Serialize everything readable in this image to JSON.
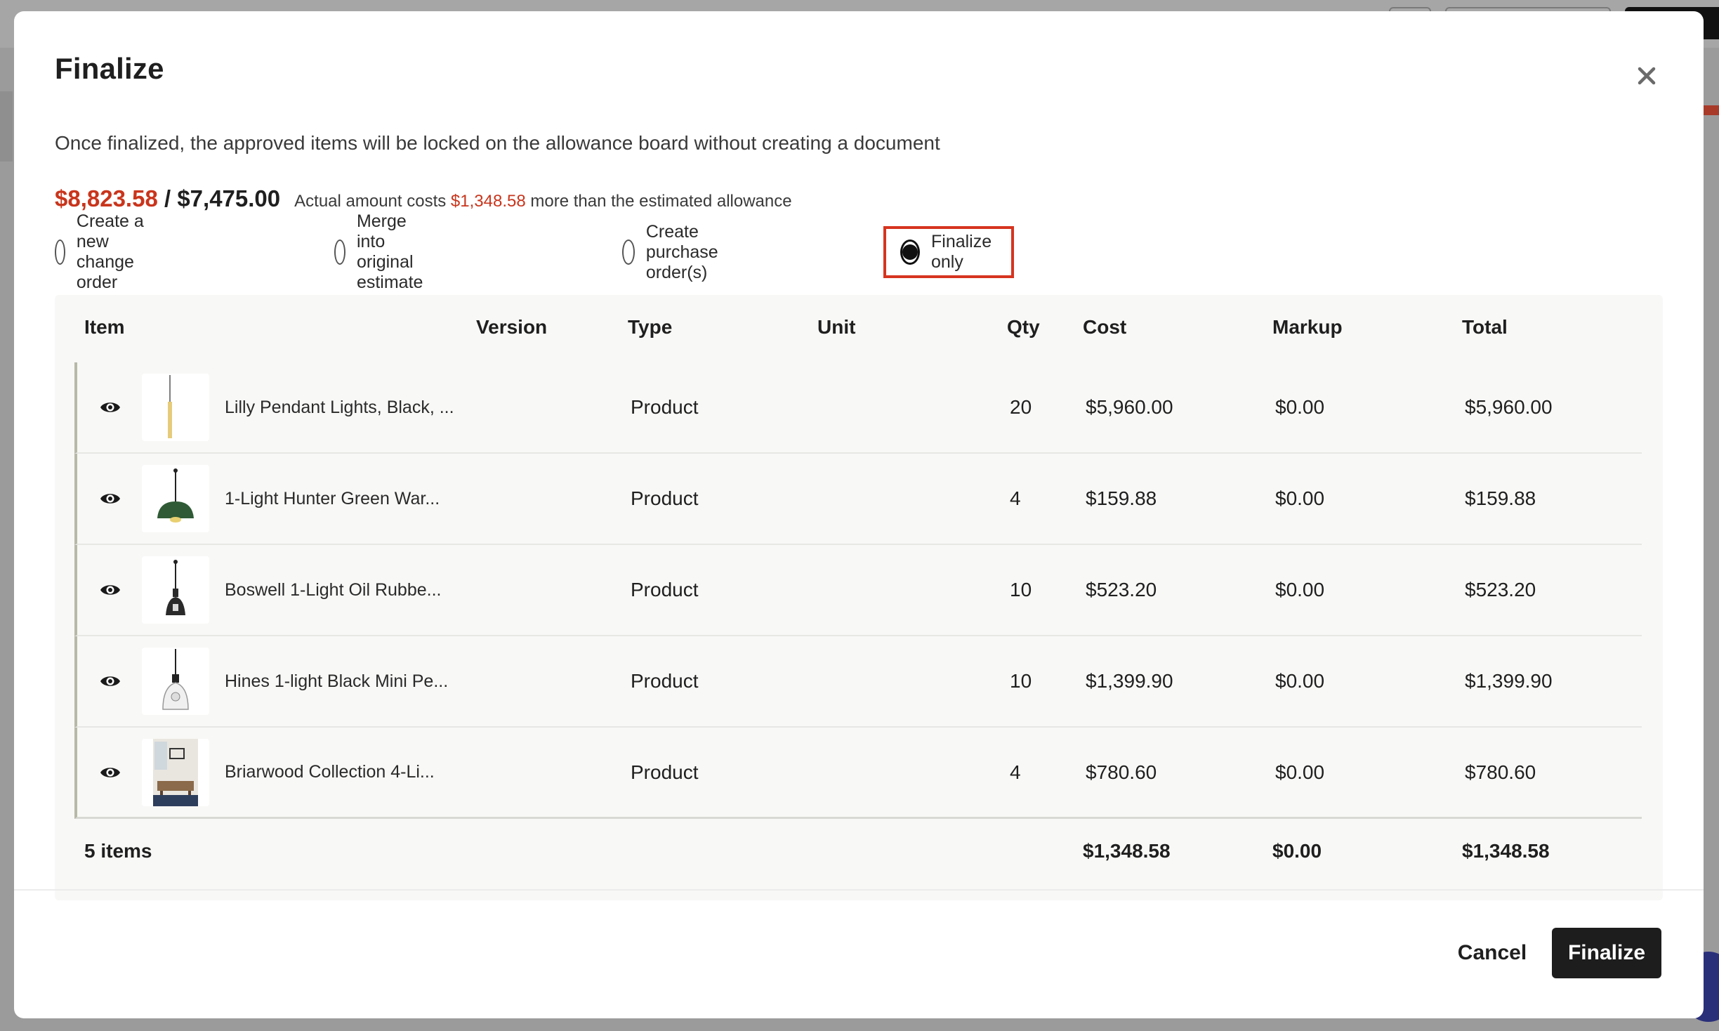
{
  "modal": {
    "title": "Finalize",
    "description": "Once finalized, the approved items will be locked on the allowance board without creating a document"
  },
  "amounts": {
    "actual": "$8,823.58",
    "separator": "/",
    "estimated": "$7,475.00",
    "note_prefix": "Actual amount costs",
    "difference": "$1,348.58",
    "note_suffix": "more than the estimated allowance"
  },
  "options": [
    {
      "label": "Create a new change order",
      "checked": false
    },
    {
      "label": "Merge into original estimate",
      "checked": false
    },
    {
      "label": "Create purchase order(s)",
      "checked": false
    },
    {
      "label": "Finalize only",
      "checked": true
    }
  ],
  "table": {
    "headers": {
      "item": "Item",
      "version": "Version",
      "type": "Type",
      "unit": "Unit",
      "qty": "Qty",
      "cost": "Cost",
      "markup": "Markup",
      "total": "Total"
    },
    "rows": [
      {
        "name": "Lilly Pendant Lights, Black, ...",
        "version": "",
        "type": "Product",
        "unit": "",
        "qty": "20",
        "cost": "$5,960.00",
        "markup": "$0.00",
        "total": "$5,960.00",
        "thumb_icon": "pendant-light-gold-icon"
      },
      {
        "name": "1-Light Hunter Green War...",
        "version": "",
        "type": "Product",
        "unit": "",
        "qty": "4",
        "cost": "$159.88",
        "markup": "$0.00",
        "total": "$159.88",
        "thumb_icon": "pendant-light-green-icon"
      },
      {
        "name": "Boswell 1-Light Oil Rubbe...",
        "version": "",
        "type": "Product",
        "unit": "",
        "qty": "10",
        "cost": "$523.20",
        "markup": "$0.00",
        "total": "$523.20",
        "thumb_icon": "pendant-light-bronze-icon"
      },
      {
        "name": "Hines 1-light Black Mini Pe...",
        "version": "",
        "type": "Product",
        "unit": "",
        "qty": "10",
        "cost": "$1,399.90",
        "markup": "$0.00",
        "total": "$1,399.90",
        "thumb_icon": "pendant-light-glass-icon"
      },
      {
        "name": "Briarwood Collection 4-Li...",
        "version": "",
        "type": "Product",
        "unit": "",
        "qty": "4",
        "cost": "$780.60",
        "markup": "$0.00",
        "total": "$780.60",
        "thumb_icon": "room-photo-icon"
      }
    ],
    "footer": {
      "count": "5 items",
      "cost": "$1,348.58",
      "markup": "$0.00",
      "total": "$1,348.58"
    }
  },
  "buttons": {
    "cancel": "Cancel",
    "finalize": "Finalize"
  },
  "colors": {
    "accent_red": "#c9351c",
    "highlight_border": "#d6341f",
    "primary_button": "#1d1d1d"
  }
}
